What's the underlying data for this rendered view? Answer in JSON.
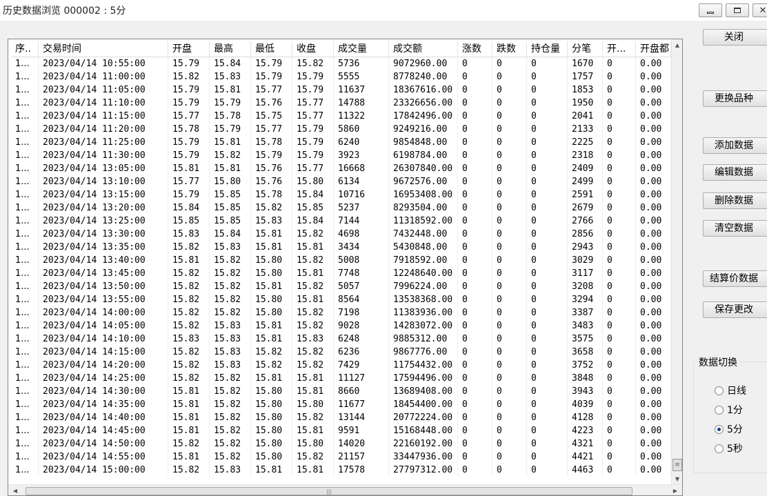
{
  "window": {
    "title": "历史数据浏览 000002 : 5分"
  },
  "columns": [
    "序..",
    "交易时间",
    "开盘",
    "最高",
    "最低",
    "收盘",
    "成交量",
    "成交额",
    "涨数",
    "跌数",
    "持仓量",
    "分笔",
    "开...",
    "开盘都"
  ],
  "rows": [
    [
      "1...",
      "2023/04/14 10:55:00",
      "15.79",
      "15.84",
      "15.79",
      "15.82",
      "5736",
      "9072960.00",
      "0",
      "0",
      "0",
      "1670",
      "0",
      "0.00"
    ],
    [
      "1...",
      "2023/04/14 11:00:00",
      "15.82",
      "15.83",
      "15.79",
      "15.79",
      "5555",
      "8778240.00",
      "0",
      "0",
      "0",
      "1757",
      "0",
      "0.00"
    ],
    [
      "1...",
      "2023/04/14 11:05:00",
      "15.79",
      "15.81",
      "15.77",
      "15.79",
      "11637",
      "18367616.00",
      "0",
      "0",
      "0",
      "1853",
      "0",
      "0.00"
    ],
    [
      "1...",
      "2023/04/14 11:10:00",
      "15.79",
      "15.79",
      "15.76",
      "15.77",
      "14788",
      "23326656.00",
      "0",
      "0",
      "0",
      "1950",
      "0",
      "0.00"
    ],
    [
      "1...",
      "2023/04/14 11:15:00",
      "15.77",
      "15.78",
      "15.75",
      "15.77",
      "11322",
      "17842496.00",
      "0",
      "0",
      "0",
      "2041",
      "0",
      "0.00"
    ],
    [
      "1...",
      "2023/04/14 11:20:00",
      "15.78",
      "15.79",
      "15.77",
      "15.79",
      "5860",
      "9249216.00",
      "0",
      "0",
      "0",
      "2133",
      "0",
      "0.00"
    ],
    [
      "1...",
      "2023/04/14 11:25:00",
      "15.79",
      "15.81",
      "15.78",
      "15.79",
      "6240",
      "9854848.00",
      "0",
      "0",
      "0",
      "2225",
      "0",
      "0.00"
    ],
    [
      "1...",
      "2023/04/14 11:30:00",
      "15.79",
      "15.82",
      "15.79",
      "15.79",
      "3923",
      "6198784.00",
      "0",
      "0",
      "0",
      "2318",
      "0",
      "0.00"
    ],
    [
      "1...",
      "2023/04/14 13:05:00",
      "15.81",
      "15.81",
      "15.76",
      "15.77",
      "16668",
      "26307840.00",
      "0",
      "0",
      "0",
      "2409",
      "0",
      "0.00"
    ],
    [
      "1...",
      "2023/04/14 13:10:00",
      "15.77",
      "15.80",
      "15.76",
      "15.80",
      "6134",
      "9672576.00",
      "0",
      "0",
      "0",
      "2499",
      "0",
      "0.00"
    ],
    [
      "1...",
      "2023/04/14 13:15:00",
      "15.79",
      "15.85",
      "15.78",
      "15.84",
      "10716",
      "16953408.00",
      "0",
      "0",
      "0",
      "2591",
      "0",
      "0.00"
    ],
    [
      "1...",
      "2023/04/14 13:20:00",
      "15.84",
      "15.85",
      "15.82",
      "15.85",
      "5237",
      "8293504.00",
      "0",
      "0",
      "0",
      "2679",
      "0",
      "0.00"
    ],
    [
      "1...",
      "2023/04/14 13:25:00",
      "15.85",
      "15.85",
      "15.83",
      "15.84",
      "7144",
      "11318592.00",
      "0",
      "0",
      "0",
      "2766",
      "0",
      "0.00"
    ],
    [
      "1...",
      "2023/04/14 13:30:00",
      "15.83",
      "15.84",
      "15.81",
      "15.82",
      "4698",
      "7432448.00",
      "0",
      "0",
      "0",
      "2856",
      "0",
      "0.00"
    ],
    [
      "1...",
      "2023/04/14 13:35:00",
      "15.82",
      "15.83",
      "15.81",
      "15.81",
      "3434",
      "5430848.00",
      "0",
      "0",
      "0",
      "2943",
      "0",
      "0.00"
    ],
    [
      "1...",
      "2023/04/14 13:40:00",
      "15.81",
      "15.82",
      "15.80",
      "15.82",
      "5008",
      "7918592.00",
      "0",
      "0",
      "0",
      "3029",
      "0",
      "0.00"
    ],
    [
      "1...",
      "2023/04/14 13:45:00",
      "15.82",
      "15.82",
      "15.80",
      "15.81",
      "7748",
      "12248640.00",
      "0",
      "0",
      "0",
      "3117",
      "0",
      "0.00"
    ],
    [
      "1...",
      "2023/04/14 13:50:00",
      "15.82",
      "15.82",
      "15.81",
      "15.82",
      "5057",
      "7996224.00",
      "0",
      "0",
      "0",
      "3208",
      "0",
      "0.00"
    ],
    [
      "1...",
      "2023/04/14 13:55:00",
      "15.82",
      "15.82",
      "15.80",
      "15.81",
      "8564",
      "13538368.00",
      "0",
      "0",
      "0",
      "3294",
      "0",
      "0.00"
    ],
    [
      "1...",
      "2023/04/14 14:00:00",
      "15.82",
      "15.82",
      "15.80",
      "15.82",
      "7198",
      "11383936.00",
      "0",
      "0",
      "0",
      "3387",
      "0",
      "0.00"
    ],
    [
      "1...",
      "2023/04/14 14:05:00",
      "15.82",
      "15.83",
      "15.81",
      "15.82",
      "9028",
      "14283072.00",
      "0",
      "0",
      "0",
      "3483",
      "0",
      "0.00"
    ],
    [
      "1...",
      "2023/04/14 14:10:00",
      "15.83",
      "15.83",
      "15.81",
      "15.83",
      "6248",
      "9885312.00",
      "0",
      "0",
      "0",
      "3575",
      "0",
      "0.00"
    ],
    [
      "1...",
      "2023/04/14 14:15:00",
      "15.82",
      "15.83",
      "15.82",
      "15.82",
      "6236",
      "9867776.00",
      "0",
      "0",
      "0",
      "3658",
      "0",
      "0.00"
    ],
    [
      "1...",
      "2023/04/14 14:20:00",
      "15.82",
      "15.83",
      "15.82",
      "15.82",
      "7429",
      "11754432.00",
      "0",
      "0",
      "0",
      "3752",
      "0",
      "0.00"
    ],
    [
      "1...",
      "2023/04/14 14:25:00",
      "15.82",
      "15.82",
      "15.81",
      "15.81",
      "11127",
      "17594496.00",
      "0",
      "0",
      "0",
      "3848",
      "0",
      "0.00"
    ],
    [
      "1...",
      "2023/04/14 14:30:00",
      "15.81",
      "15.82",
      "15.80",
      "15.81",
      "8660",
      "13689408.00",
      "0",
      "0",
      "0",
      "3943",
      "0",
      "0.00"
    ],
    [
      "1...",
      "2023/04/14 14:35:00",
      "15.81",
      "15.82",
      "15.80",
      "15.80",
      "11677",
      "18454400.00",
      "0",
      "0",
      "0",
      "4039",
      "0",
      "0.00"
    ],
    [
      "1...",
      "2023/04/14 14:40:00",
      "15.81",
      "15.82",
      "15.80",
      "15.82",
      "13144",
      "20772224.00",
      "0",
      "0",
      "0",
      "4128",
      "0",
      "0.00"
    ],
    [
      "1...",
      "2023/04/14 14:45:00",
      "15.81",
      "15.82",
      "15.80",
      "15.81",
      "9591",
      "15168448.00",
      "0",
      "0",
      "0",
      "4223",
      "0",
      "0.00"
    ],
    [
      "1...",
      "2023/04/14 14:50:00",
      "15.82",
      "15.82",
      "15.80",
      "15.80",
      "14020",
      "22160192.00",
      "0",
      "0",
      "0",
      "4321",
      "0",
      "0.00"
    ],
    [
      "1...",
      "2023/04/14 14:55:00",
      "15.81",
      "15.82",
      "15.80",
      "15.82",
      "21157",
      "33447936.00",
      "0",
      "0",
      "0",
      "4421",
      "0",
      "0.00"
    ],
    [
      "1...",
      "2023/04/14 15:00:00",
      "15.82",
      "15.83",
      "15.81",
      "15.81",
      "17578",
      "27797312.00",
      "0",
      "0",
      "0",
      "4463",
      "0",
      "0.00"
    ]
  ],
  "buttons": {
    "close": "关闭",
    "change_symbol": "更换品种",
    "add_data": "添加数据",
    "edit_data": "编辑数据",
    "delete_data": "删除数据",
    "clear_data": "清空数据",
    "settlement_data": "结算价数据",
    "save_changes": "保存更改"
  },
  "data_switch": {
    "title": "数据切换",
    "options": [
      "日线",
      "1分",
      "5分",
      "5秒"
    ],
    "selected": "5分"
  },
  "colors": {
    "window_bg": "#f0f0f0",
    "grid_bg": "#ffffff",
    "radio_dot": "#1a3a8a"
  }
}
